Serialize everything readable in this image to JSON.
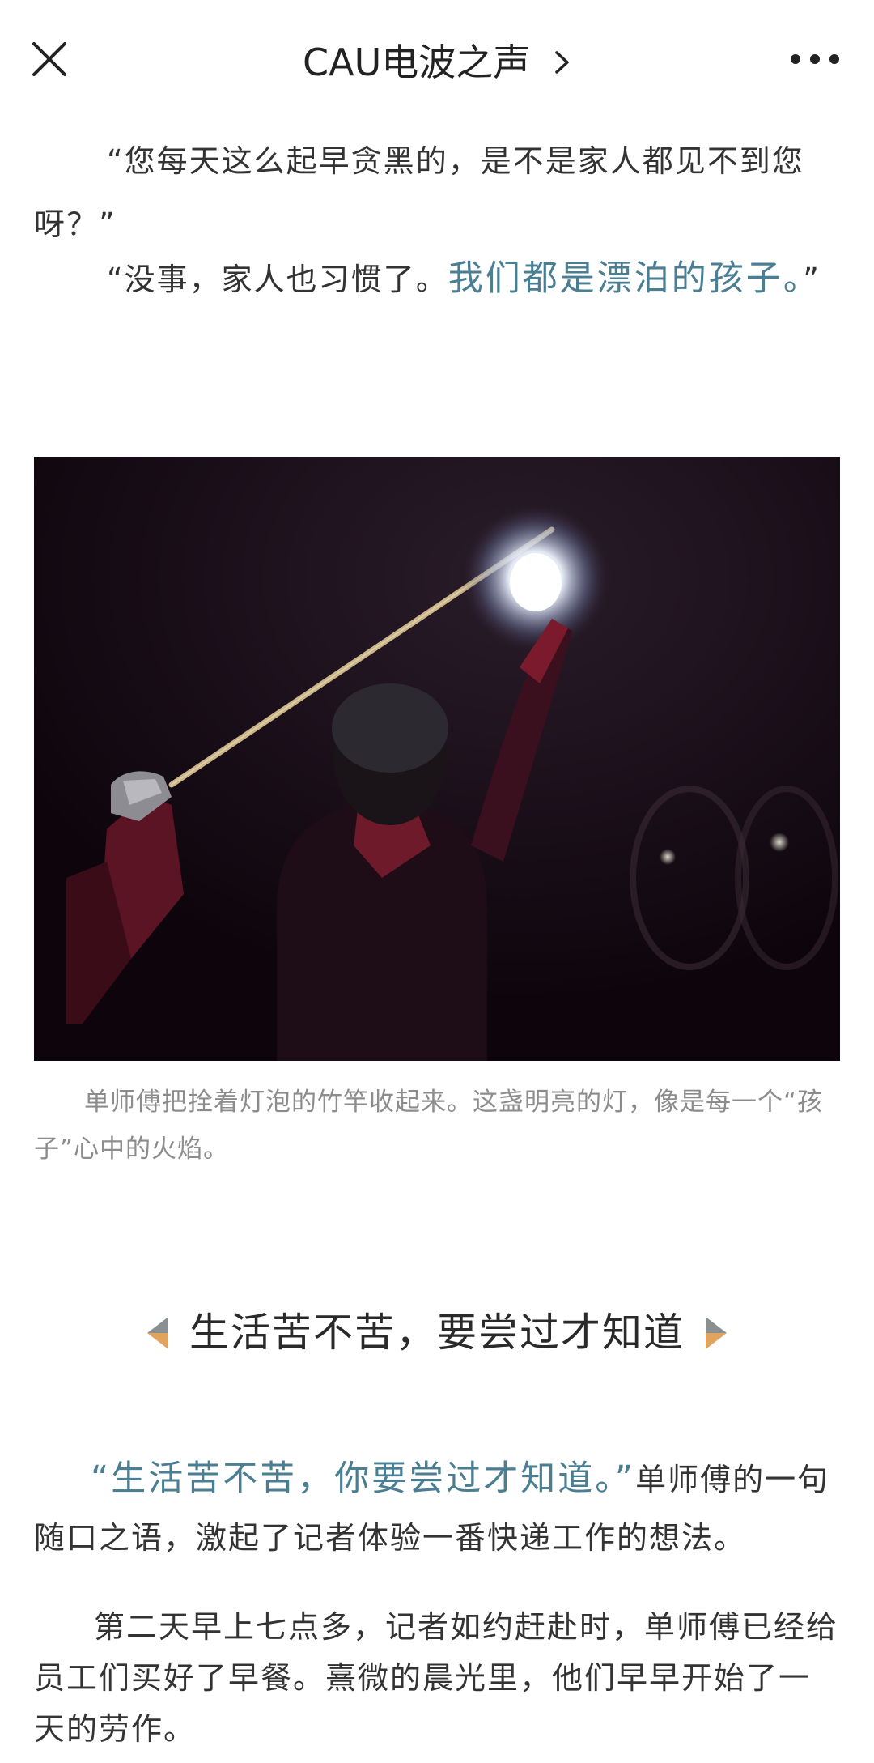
{
  "header": {
    "title": "CAU电波之声",
    "close_icon": "close-icon",
    "chevron_icon": "chevron-right-icon",
    "more_icon": "more-dots-icon"
  },
  "article": {
    "dialog_q": "“您每天这么起早贪黑的，是不是家人都见不到您呀？”",
    "dialog_a_plain": "“没事，家人也习惯了。",
    "dialog_a_highlight": "我们都是漂泊的孩子。",
    "dialog_a_end": "”",
    "photo_caption": "单师傅把拴着灯泡的竹竿收起来。这盏明亮的灯，像是每一个“孩子”心中的火焰。",
    "section_title": "生活苦不苦，要尝过才知道",
    "para1_highlight": "“生活苦不苦，你要尝过才知道。”",
    "para1_rest": "单师傅的一句随口之语，激起了记者体验一番快递工作的想法。",
    "para2": "第二天早上七点多，记者如约赶赴时，单师傅已经给员工们买好了早餐。熹微的晨光里，他们早早开始了一天的劳作。"
  },
  "colors": {
    "highlight": "#4a7e92",
    "body_text": "#333333",
    "caption_text": "#8c8c8c",
    "triangle_grey": "#8a8f92",
    "triangle_orange": "#e0a45f"
  }
}
